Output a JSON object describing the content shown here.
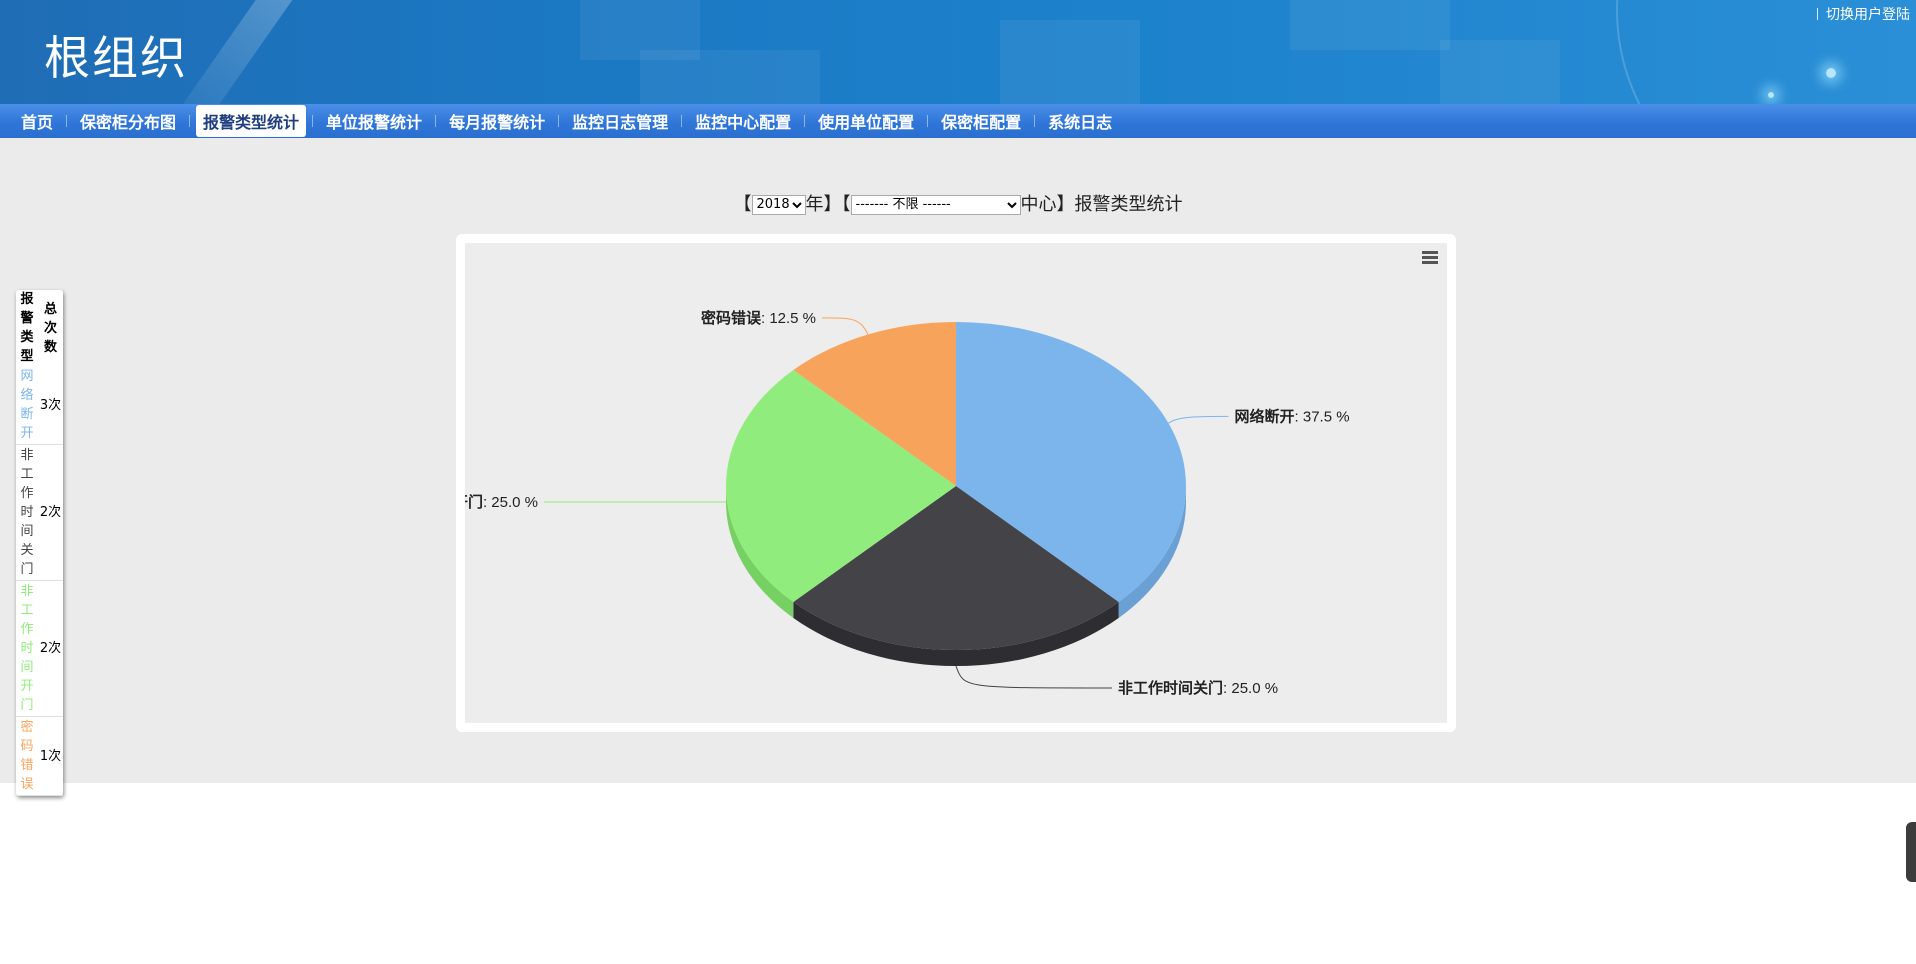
{
  "header": {
    "org_title": "根组织",
    "switch_user": "切换用户登陆"
  },
  "nav": {
    "items": [
      {
        "label": "首页"
      },
      {
        "label": "保密柜分布图"
      },
      {
        "label": "报警类型统计"
      },
      {
        "label": "单位报警统计"
      },
      {
        "label": "每月报警统计"
      },
      {
        "label": "监控日志管理"
      },
      {
        "label": "监控中心配置"
      },
      {
        "label": "使用单位配置"
      },
      {
        "label": "保密柜配置"
      },
      {
        "label": "系统日志"
      }
    ],
    "active_index": 2
  },
  "filter": {
    "bracket_open": "【",
    "year_value": "2018",
    "year_suffix": "年】",
    "bracket_open2": "【",
    "center_value": "------- 不限 ------",
    "center_suffix": "中心】",
    "title_text": "报警类型统计"
  },
  "side_table": {
    "header_type": "报警类型",
    "header_count": "总次数",
    "rows": [
      {
        "type": "网络断开",
        "count": "3次",
        "color": "#7cb5ec"
      },
      {
        "type": "非工作时间关门",
        "count": "2次",
        "color": "#434348"
      },
      {
        "type": "非工作时间开门",
        "count": "2次",
        "color": "#90ed7d"
      },
      {
        "type": "密码错误",
        "count": "1次",
        "color": "#f7a35c"
      }
    ]
  },
  "chart_data": {
    "type": "pie",
    "title": "",
    "slices": [
      {
        "name": "网络断开",
        "value": 37.5,
        "label_value": "37.5 %",
        "color": "#7cb5ec",
        "side_color": "#6aa0d4"
      },
      {
        "name": "非工作时间关门",
        "value": 25.0,
        "label_value": "25.0 %",
        "color": "#434348",
        "side_color": "#2e2e32"
      },
      {
        "name": "非工作时间开门",
        "value": 25.0,
        "label_value": "25.0 %",
        "color": "#90ed7d",
        "side_color": "#77d064"
      },
      {
        "name": "密码错误",
        "value": 12.5,
        "label_value": "12.5 %",
        "color": "#f7a35c",
        "side_color": "#dc8c47"
      }
    ],
    "percent_suffix": "%",
    "three_d": true,
    "legend": "none"
  }
}
